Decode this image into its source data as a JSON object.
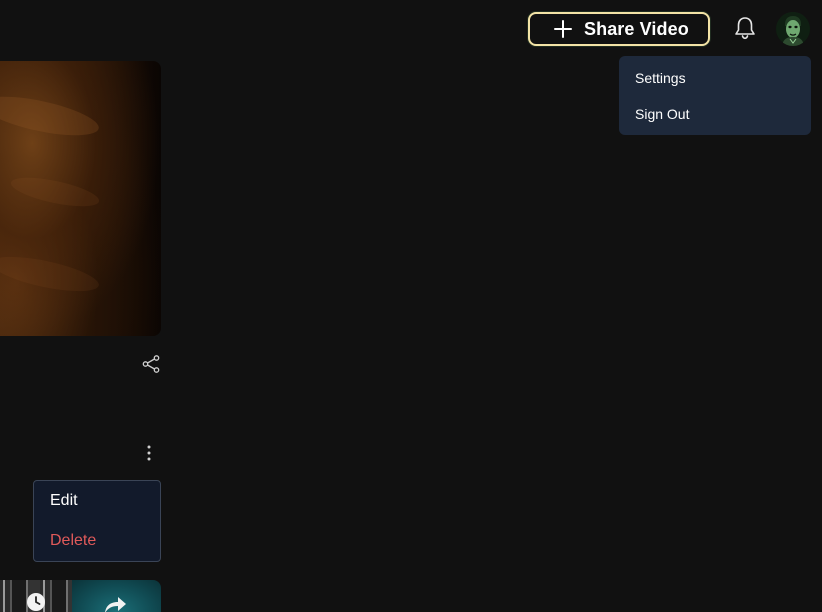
{
  "header": {
    "share_button_label": "Share Video",
    "share_icon": "plus-icon",
    "notification_icon": "bell-icon",
    "avatar_icon": "avatar",
    "share_button_border_color": "#f3e3a6"
  },
  "account_menu": {
    "items": [
      {
        "label": "Settings"
      },
      {
        "label": "Sign Out"
      }
    ],
    "background_color": "#1e293b"
  },
  "video_card": {
    "share_icon": "share-icon",
    "more_icon": "more-vertical-icon"
  },
  "item_menu": {
    "edit_label": "Edit",
    "delete_label": "Delete",
    "delete_color": "#e05a5a"
  },
  "bottom_thumbnails": {
    "icons": [
      "clock-icon",
      "forward-icon"
    ]
  }
}
